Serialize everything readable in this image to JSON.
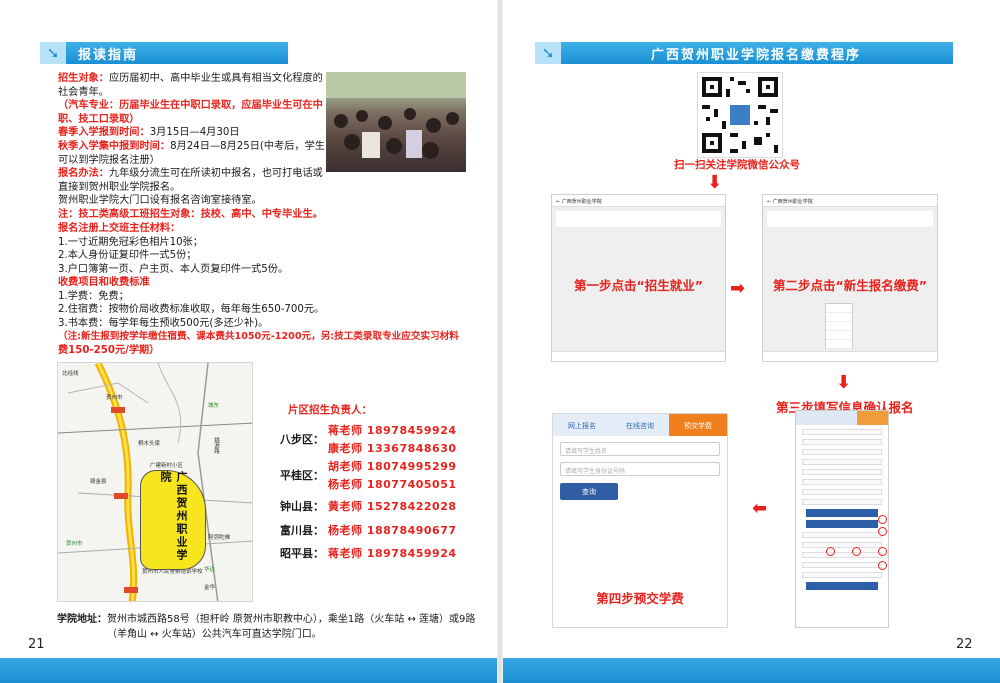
{
  "left_page": {
    "header": {
      "title": "报读指南"
    },
    "enrollment": {
      "l1": "招生对象：",
      "l1b": "应历届初中、高中毕业生或具有相当文化程度的",
      "l2": "社会青年。",
      "l3": "（汽车专业：历届毕业生在中职口录取，应届毕业生可在中",
      "l4": "职、技工口录取）",
      "l5a": "春季入学报到时间：",
      "l5b": "3月15日—4月30日",
      "l6a": "秋季入学集中报到时间：",
      "l6b": "8月24日—8月25日(中考后，学生",
      "l7": "可以到学院报名注册）",
      "l8a": "报名办法：",
      "l8b": "九年级分流生可在所读初中报名，也可打电话或",
      "l9": "直接到贺州职业学院报名。",
      "l10": "贺州职业学院大门口设有报名咨询室接待室。",
      "l11": "注：技工类高级工班招生对象：技校、高中、中专毕业生。"
    },
    "materials": {
      "title": "报名注册上交班主任材料：",
      "items": [
        "1.一寸近期免冠彩色相片10张；",
        "2.本人身份证复印件一式5份；",
        "3.户口簿第一页、户主页、本人页复印件一式5份。"
      ]
    },
    "fees": {
      "title": "收费项目和收费标准",
      "items": [
        "1.学费：免费；",
        "2.住宿费：按物价局收费标准收取，每年每生650-700元。",
        "3.书本费：每学年每生预收500元(多还少补)。"
      ],
      "note1": "（注:新生报到按学年缴住宿费、课本费共1050元-1200元，另:技工类录取专业应交实习材料",
      "note2": "费150-250元/学期）"
    },
    "map": {
      "campus_label": "广西贺州职业学院",
      "labels": [
        "北经线",
        "贺州市",
        "城东",
        "广建新村小区",
        "桐木头梁",
        "贺州市人民警察培训学校",
        "阿弥陀佛",
        "赣金县",
        "金华",
        "华达",
        "贺州市",
        "姚源路"
      ]
    },
    "contacts": {
      "title": "片区招生负责人：",
      "rows": [
        {
          "area": "八步区：",
          "teachers": [
            "蒋老师 18978459924",
            "康老师 13367848630"
          ]
        },
        {
          "area": "平桂区：",
          "teachers": [
            "胡老师 18074995299",
            "杨老师 18077405051"
          ]
        },
        {
          "area": "钟山县：",
          "teachers": [
            "黄老师 15278422028"
          ]
        },
        {
          "area": "富川县：",
          "teachers": [
            "杨老师 18878490677"
          ]
        },
        {
          "area": "昭平县：",
          "teachers": [
            "蒋老师 18978459924"
          ]
        }
      ]
    },
    "address": {
      "label": "学院地址：",
      "line1": "贺州市城西路58号（担杆岭  原贺州市职教中心），乘坐1路（火车站 ↔ 莲塘）或9路",
      "line2": "（羊角山 ↔ 火车站）公共汽车可直达学院门口。"
    },
    "page_number": "21"
  },
  "right_page": {
    "header": {
      "title": "广西贺州职业学院报名缴费程序"
    },
    "qr_caption": "扫一扫关注学院微信公众号",
    "step1": {
      "screen_title": "← 广西贺州职业学院",
      "text": "第一步点击“招生就业”"
    },
    "step2": {
      "screen_title": "← 广西贺州职业学院",
      "text": "第二步点击“新生报名缴费”"
    },
    "step3": {
      "text": "第三步填写信息确认报名"
    },
    "step4": {
      "tabs": [
        "网上报名",
        "在线咨询",
        "预交学费"
      ],
      "name_placeholder": "请填写学生姓名",
      "id_placeholder": "请填写学生身份证号码",
      "query_label": "查询",
      "text": "第四步预交学费"
    },
    "page_number": "22"
  },
  "colors": {
    "accent": "#1a8fd3",
    "highlight": "#e8231d",
    "campus": "#f7e61d"
  }
}
